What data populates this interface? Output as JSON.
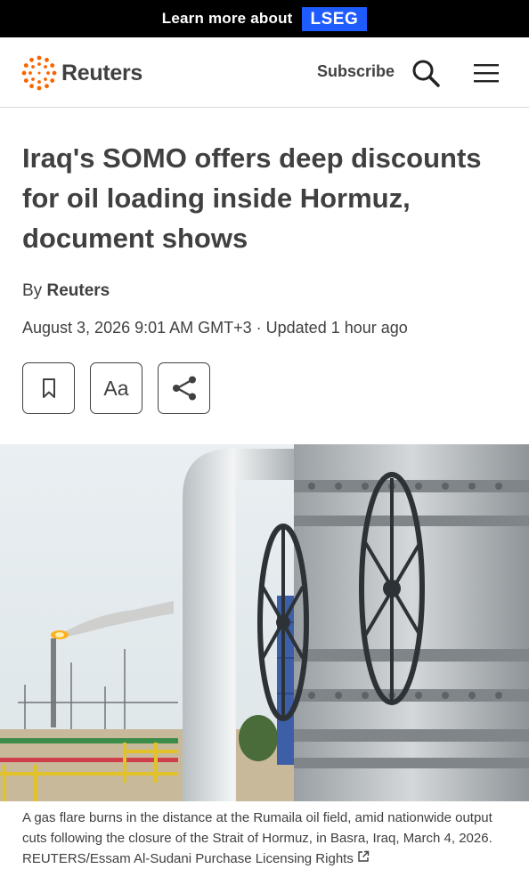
{
  "banner": {
    "learn_text": "Learn more about",
    "brand_text": "LSEG"
  },
  "header": {
    "logo_text": "Reuters",
    "subscribe_label": "Subscribe"
  },
  "article": {
    "headline": "Iraq's SOMO offers deep discounts for oil loading inside Hormuz, document shows",
    "by_prefix": "By",
    "author": "Reuters",
    "dateline": "August 3, 2026 9:01 AM GMT+3 · Updated 1 hour ago",
    "font_button_label": "Aa",
    "caption": "A gas flare burns in the distance at the Rumaila oil field, amid nationwide output cuts following the closure of the Strait of Hormuz, in Basra, Iraq, March 4, 2026. REUTERS/Essam Al-Sudani Purchase Licensing Rights"
  },
  "icons": {
    "logo": "reuters-logo-icon",
    "search": "search-icon",
    "menu": "menu-icon",
    "bookmark": "bookmark-icon",
    "share": "share-icon",
    "external_link": "external-link-icon"
  },
  "colors": {
    "banner_bg": "#000000",
    "brand_blue": "#1e5cff",
    "logo_orange": "#fa6400",
    "text": "#404040"
  }
}
